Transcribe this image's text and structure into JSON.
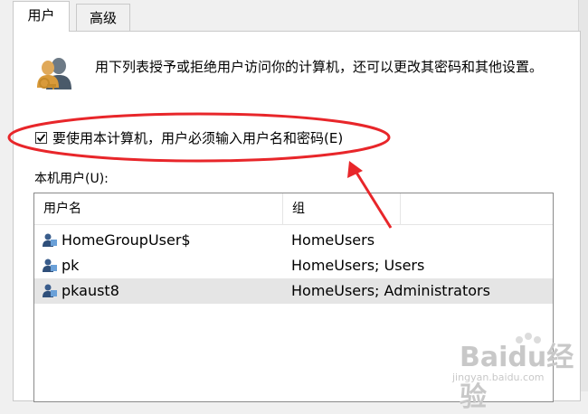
{
  "tabs": [
    {
      "label": "用户",
      "active": true
    },
    {
      "label": "高级",
      "active": false
    }
  ],
  "description": "用下列表授予或拒绝用户访问你的计算机，还可以更改其密码和其他设置。",
  "require_login": {
    "label": "要使用本计算机，用户必须输入用户名和密码(E)",
    "checked": true
  },
  "users_section_label": "本机用户(U):",
  "columns": [
    "用户名",
    "组"
  ],
  "users": [
    {
      "name": "HomeGroupUser$",
      "group": "HomeUsers",
      "selected": false
    },
    {
      "name": "pk",
      "group": "HomeUsers; Users",
      "selected": false
    },
    {
      "name": "pkaust8",
      "group": "HomeUsers; Administrators",
      "selected": true
    }
  ],
  "annotation_color": "#e8262a",
  "watermark": {
    "brand": "Baidu经验",
    "url": "jingyan.baidu.com"
  }
}
